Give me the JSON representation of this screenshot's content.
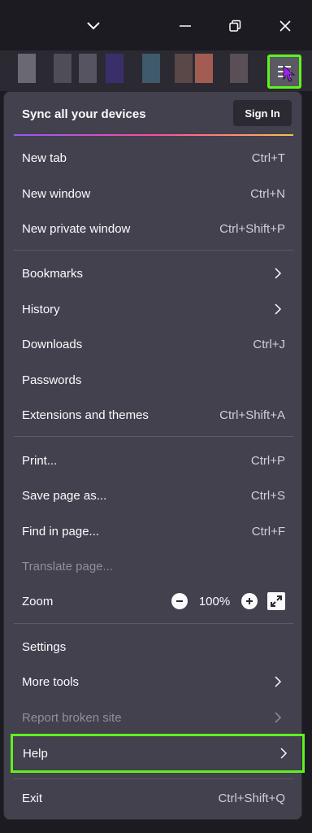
{
  "colors": {
    "accent": "#5ef21e",
    "menu_bg": "#42414d",
    "text": "#fbfbfe",
    "disabled_text": "#8f8f9d"
  },
  "sync": {
    "label": "Sync all your devices",
    "signin": "Sign In"
  },
  "items": {
    "new_tab": {
      "label": "New tab",
      "shortcut": "Ctrl+T"
    },
    "new_window": {
      "label": "New window",
      "shortcut": "Ctrl+N"
    },
    "new_private": {
      "label": "New private window",
      "shortcut": "Ctrl+Shift+P"
    },
    "bookmarks": {
      "label": "Bookmarks"
    },
    "history": {
      "label": "History"
    },
    "downloads": {
      "label": "Downloads",
      "shortcut": "Ctrl+J"
    },
    "passwords": {
      "label": "Passwords"
    },
    "extensions": {
      "label": "Extensions and themes",
      "shortcut": "Ctrl+Shift+A"
    },
    "print": {
      "label": "Print...",
      "shortcut": "Ctrl+P"
    },
    "save_page": {
      "label": "Save page as...",
      "shortcut": "Ctrl+S"
    },
    "find": {
      "label": "Find in page...",
      "shortcut": "Ctrl+F"
    },
    "translate": {
      "label": "Translate page..."
    },
    "zoom": {
      "label": "Zoom",
      "value": "100%"
    },
    "settings": {
      "label": "Settings"
    },
    "more_tools": {
      "label": "More tools"
    },
    "report": {
      "label": "Report broken site"
    },
    "help": {
      "label": "Help"
    },
    "exit": {
      "label": "Exit",
      "shortcut": "Ctrl+Shift+Q"
    }
  }
}
